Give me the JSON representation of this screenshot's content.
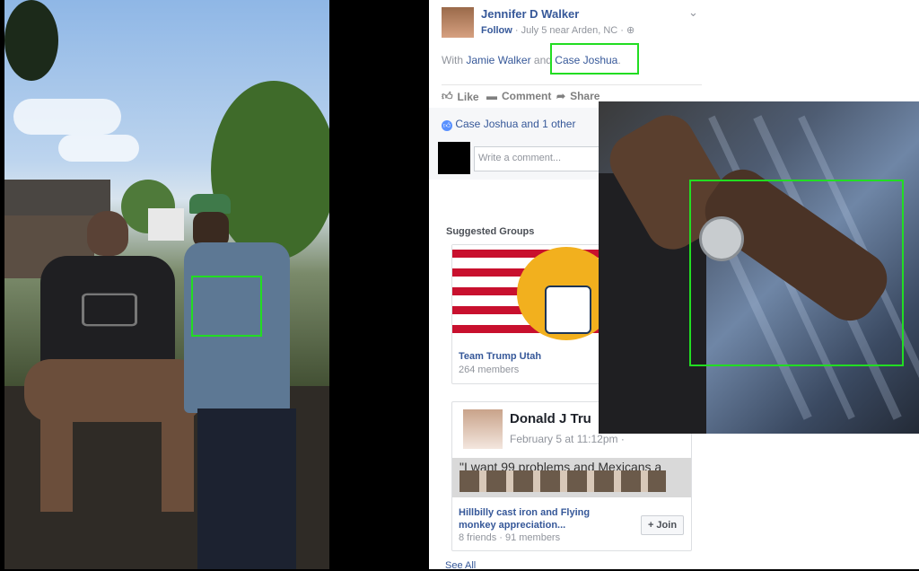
{
  "post": {
    "author": "Jennifer D Walker",
    "follow": "Follow",
    "meta": "· July 5 near Arden, NC ·",
    "with_prefix": "With",
    "tagged1": "Jamie Walker",
    "and": "and",
    "tagged2": "Case Joshua",
    "tagged2_suffix": ".",
    "actions": {
      "like": "Like",
      "comment": "Comment",
      "share": "Share"
    },
    "likes_text": "Case Joshua and 1 other",
    "comment_placeholder": "Write a comment..."
  },
  "suggested": {
    "title": "Suggested Groups",
    "group1": {
      "name": "Team Trump Utah",
      "members": "264 members"
    },
    "group2": {
      "poster_name": "Donald J Tru",
      "poster_date": "February 5 at 11:12pm ·",
      "poster_snippet": "\"I want 99 problems and Mexicans a",
      "name": "Hillbilly cast iron and Flying monkey appreciation...",
      "members": "8 friends · 91 members",
      "join": "+ Join"
    },
    "see_all": "See All"
  },
  "colors": {
    "highlight": "#22dd22",
    "fb_link": "#365899",
    "fb_meta": "#90949c"
  }
}
